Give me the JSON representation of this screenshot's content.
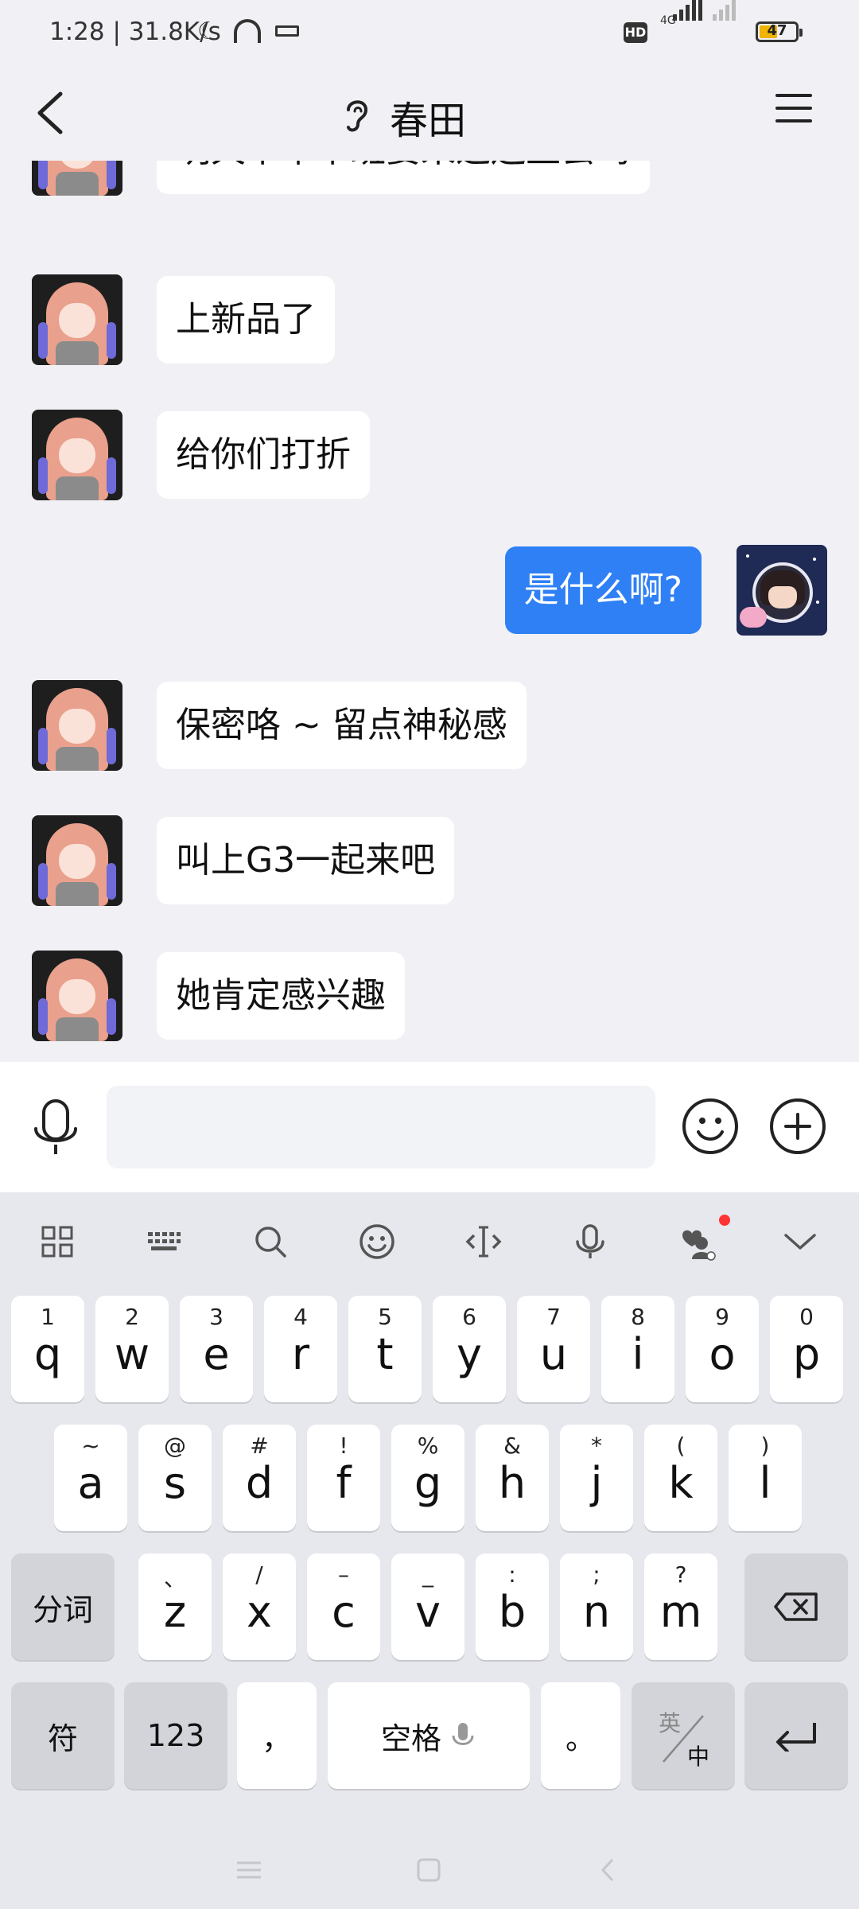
{
  "status_bar": {
    "time": "1:28",
    "speed": "31.8K/s",
    "network": "4G",
    "hd_badge": "HD",
    "battery": "47"
  },
  "header": {
    "title": "春田",
    "back_icon": "chevron-left-icon",
    "menu_icon": "menu-icon"
  },
  "messages": [
    {
      "sender": "other",
      "text": "明天下午下班要来这边坐会吗"
    },
    {
      "sender": "other",
      "text": "上新品了"
    },
    {
      "sender": "other",
      "text": "给你们打折"
    },
    {
      "sender": "me",
      "text": "是什么啊?"
    },
    {
      "sender": "other",
      "text": "保密咯 ~ 留点神秘感"
    },
    {
      "sender": "other",
      "text": "叫上G3一起来吧"
    },
    {
      "sender": "other",
      "text": "她肯定感兴趣"
    }
  ],
  "input": {
    "value": "",
    "placeholder": ""
  },
  "keyboard": {
    "row1": [
      {
        "main": "q",
        "sub": "1"
      },
      {
        "main": "w",
        "sub": "2"
      },
      {
        "main": "e",
        "sub": "3"
      },
      {
        "main": "r",
        "sub": "4"
      },
      {
        "main": "t",
        "sub": "5"
      },
      {
        "main": "y",
        "sub": "6"
      },
      {
        "main": "u",
        "sub": "7"
      },
      {
        "main": "i",
        "sub": "8"
      },
      {
        "main": "o",
        "sub": "9"
      },
      {
        "main": "p",
        "sub": "0"
      }
    ],
    "row2": [
      {
        "main": "a",
        "sub": "~"
      },
      {
        "main": "s",
        "sub": "@"
      },
      {
        "main": "d",
        "sub": "#"
      },
      {
        "main": "f",
        "sub": "!"
      },
      {
        "main": "g",
        "sub": "%"
      },
      {
        "main": "h",
        "sub": "&"
      },
      {
        "main": "j",
        "sub": "*"
      },
      {
        "main": "k",
        "sub": "("
      },
      {
        "main": "l",
        "sub": ")"
      }
    ],
    "row3": [
      {
        "main": "z",
        "sub": "、"
      },
      {
        "main": "x",
        "sub": "/"
      },
      {
        "main": "c",
        "sub": "–"
      },
      {
        "main": "v",
        "sub": "_"
      },
      {
        "main": "b",
        "sub": ":"
      },
      {
        "main": "n",
        "sub": ";"
      },
      {
        "main": "m",
        "sub": "?"
      }
    ],
    "segment_label": "分词",
    "symbol_label": "符",
    "num_label": "123",
    "comma_label": "，",
    "space_label": "空格",
    "period_label": "。",
    "lang_top": "英",
    "lang_bottom": "中"
  }
}
